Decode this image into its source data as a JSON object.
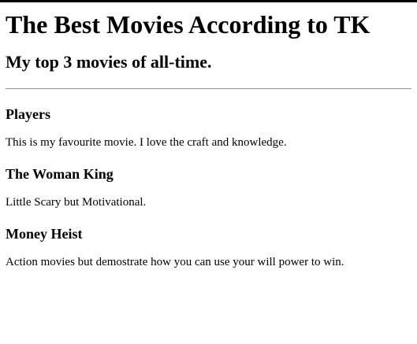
{
  "header": {
    "title": "The Best Movies According to TK",
    "subtitle": "My top 3 movies of all-time."
  },
  "movies": [
    {
      "title": "Players",
      "description": "This is my favourite movie. I love the craft and knowledge."
    },
    {
      "title": "The Woman King",
      "description": "Little Scary but Motivational."
    },
    {
      "title": "Money Heist",
      "description": "Action movies but demostrate how you can use your will power to win."
    }
  ]
}
